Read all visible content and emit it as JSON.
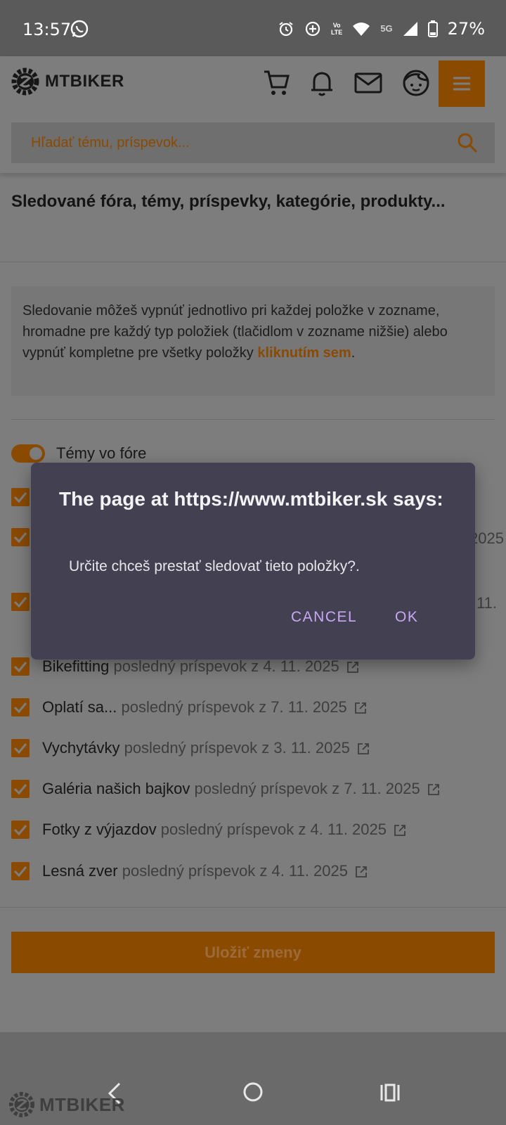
{
  "status_bar": {
    "time": "13:57",
    "battery": "27%",
    "network_5g": "5G",
    "volte_top": "Vo",
    "volte_bottom": "LTE"
  },
  "header": {
    "brand": "MTBIKER",
    "search_placeholder": "Hľadať tému, príspevok...",
    "accent_color": "#8a4a00"
  },
  "page": {
    "title": "Sledované fóra, témy, príspevky, kategórie, produkty...",
    "info_text": "Sledovanie môžeš vypnúť jednotlivo pri každej položke v zozname, hromadne pre každý typ položiek (tlačidlom v zozname nižšie) alebo vypnúť kompletne pre všetky položky ",
    "info_link": "kliknutím sem",
    "info_end": ".",
    "section_label": "Témy vo fóre",
    "partial_right_1": "2025",
    "partial_right_2": "11.",
    "items": [
      {
        "name": "Bikefitting",
        "meta": "posledný príspevok z 4. 11. 2025"
      },
      {
        "name": "Oplatí sa...",
        "meta": "posledný príspevok z 7. 11. 2025"
      },
      {
        "name": "Vychytávky",
        "meta": "posledný príspevok z 3. 11. 2025"
      },
      {
        "name": "Galéria našich bajkov",
        "meta": "posledný príspevok z 7. 11. 2025"
      },
      {
        "name": "Fotky z výjazdov",
        "meta": "posledný príspevok z 4. 11. 2025"
      },
      {
        "name": "Lesná zver",
        "meta": "posledný príspevok z 4. 11. 2025"
      }
    ],
    "save_label": "Uložiť zmeny"
  },
  "dialog": {
    "title": "The page at https://www.mtbiker.sk says:",
    "message": "Určite chceš prestať sledovať tieto položky?.",
    "cancel": "CANCEL",
    "ok": "OK",
    "button_color": "#c8a8f4"
  },
  "watermark": "MTBIKER"
}
